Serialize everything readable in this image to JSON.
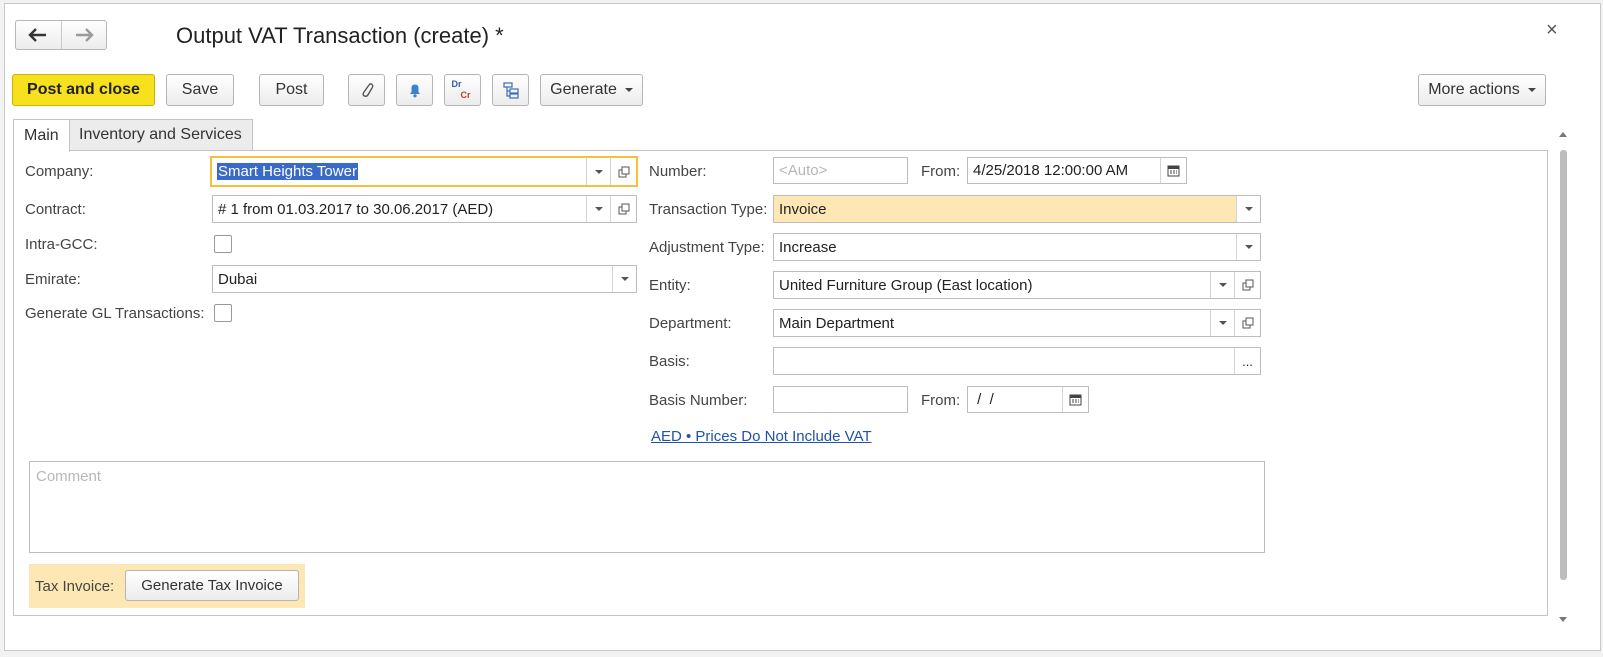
{
  "window": {
    "title": "Output VAT Transaction (create) *",
    "close_glyph": "×"
  },
  "nav": {
    "back_icon": "arrow-left-icon",
    "forward_icon": "arrow-right-icon"
  },
  "toolbar": {
    "post_and_close": "Post and close",
    "save": "Save",
    "post": "Post",
    "generate": "Generate",
    "more_actions": "More actions",
    "icons": [
      "paperclip-icon",
      "bell-icon",
      "dr-cr-icon",
      "structure-icon"
    ],
    "drcr_dr": "Dr",
    "drcr_cr": "Cr"
  },
  "tabs": [
    {
      "label": "Main",
      "active": true
    },
    {
      "label": "Inventory and Services",
      "active": false
    }
  ],
  "left": {
    "company_label": "Company:",
    "company_value": "Smart Heights Tower",
    "contract_label": "Contract:",
    "contract_value": "# 1 from 01.03.2017 to 30.06.2017 (AED)",
    "intra_gcc_label": "Intra-GCC:",
    "intra_gcc_checked": false,
    "emirate_label": "Emirate:",
    "emirate_value": "Dubai",
    "generate_gl_label": "Generate GL Transactions:",
    "generate_gl_checked": false
  },
  "right": {
    "number_label": "Number:",
    "number_placeholder": "<Auto>",
    "from_label": "From:",
    "from_value": "4/25/2018 12:00:00 AM",
    "transaction_type_label": "Transaction Type:",
    "transaction_type_value": "Invoice",
    "adjustment_type_label": "Adjustment Type:",
    "adjustment_type_value": "Increase",
    "entity_label": "Entity:",
    "entity_value": "United Furniture Group (East location)",
    "department_label": "Department:",
    "department_value": "Main Department",
    "basis_label": "Basis:",
    "basis_value": "",
    "basis_dots": "...",
    "basis_number_label": "Basis Number:",
    "basis_number_value": "",
    "basis_from_label": "From:",
    "basis_from_value": " /  /",
    "currency_link": "AED • Prices Do Not Include VAT"
  },
  "comment": {
    "placeholder": "Comment"
  },
  "tax_invoice": {
    "label": "Tax Invoice:",
    "button": "Generate Tax Invoice"
  },
  "colors": {
    "primary_button": "#f7e11e",
    "highlight_field": "#fde7b4",
    "focus_border": "#f3c23c",
    "selection": "#3a6ac9",
    "link": "#1f54a6"
  }
}
